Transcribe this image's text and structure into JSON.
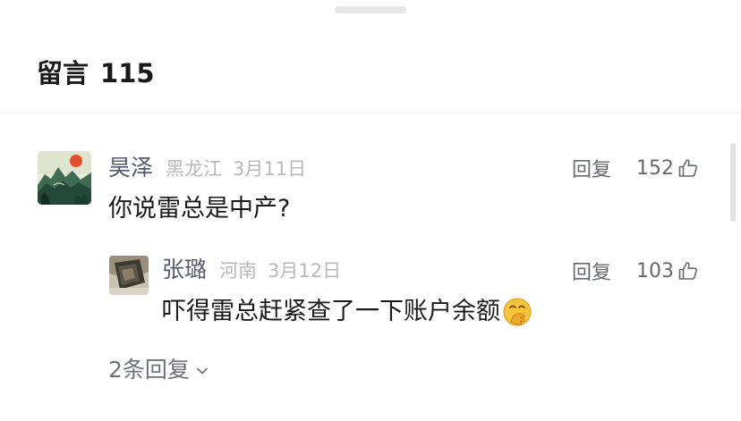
{
  "header": {
    "title": "留言",
    "count": "115"
  },
  "comments": [
    {
      "author": "昊泽",
      "location": "黑龙江",
      "date": "3月11日",
      "text": "你说雷总是中产?",
      "reply_label": "回复",
      "likes": "152",
      "avatar_icon": "landscape-painting-avatar"
    },
    {
      "author": "张璐",
      "location": "河南",
      "date": "3月12日",
      "text": "吓得雷总赶紧查了一下账户余额",
      "emoji": "🤭",
      "reply_label": "回复",
      "likes": "103",
      "avatar_icon": "photo-avatar"
    }
  ],
  "more_replies": "2条回复",
  "icons": {
    "like": "thumbs-up-icon",
    "expand": "chevron-down-icon"
  },
  "colors": {
    "name": "#555a6e",
    "meta": "#b8b8b8",
    "text": "#1a1a1a",
    "action": "#666a70"
  }
}
